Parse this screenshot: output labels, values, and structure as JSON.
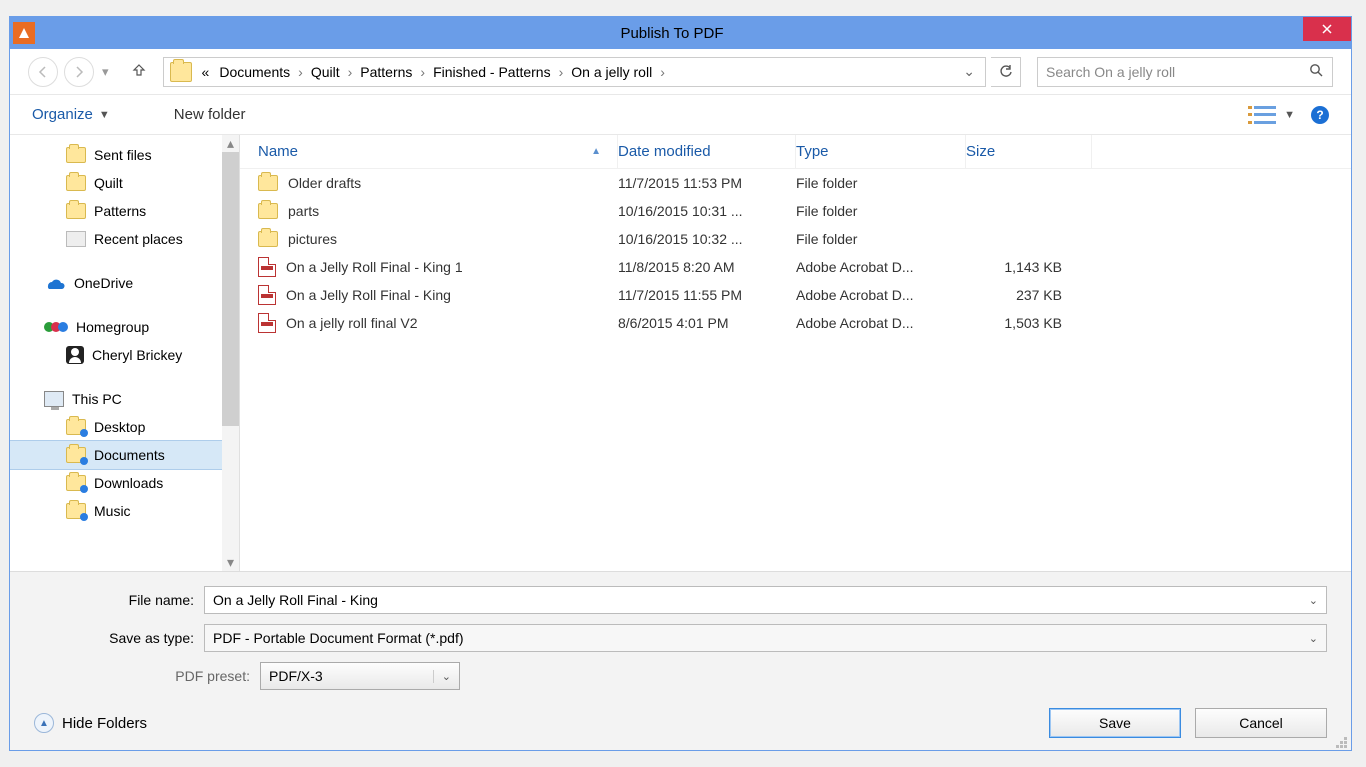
{
  "window": {
    "title": "Publish To PDF"
  },
  "breadcrumbs": {
    "prefix": "«",
    "items": [
      "Documents",
      "Quilt",
      "Patterns",
      "Finished - Patterns",
      "On a jelly roll"
    ]
  },
  "search": {
    "placeholder": "Search On a jelly roll"
  },
  "toolbar": {
    "organize": "Organize",
    "newfolder": "New folder"
  },
  "sidebar": {
    "items": [
      {
        "icon": "folder",
        "label": "Sent files",
        "indent": "sub"
      },
      {
        "icon": "folder",
        "label": "Quilt",
        "indent": "sub"
      },
      {
        "icon": "folder",
        "label": "Patterns",
        "indent": "sub"
      },
      {
        "icon": "recent",
        "label": "Recent places",
        "indent": "sub"
      },
      {
        "gap": true
      },
      {
        "icon": "onedrive",
        "label": "OneDrive",
        "indent": "top"
      },
      {
        "gap": true
      },
      {
        "icon": "homegroup",
        "label": "Homegroup",
        "indent": "top"
      },
      {
        "icon": "user",
        "label": "Cheryl Brickey",
        "indent": "sub"
      },
      {
        "gap": true
      },
      {
        "icon": "pc",
        "label": "This PC",
        "indent": "top"
      },
      {
        "icon": "folder-blue",
        "label": "Desktop",
        "indent": "sub"
      },
      {
        "icon": "folder-blue",
        "label": "Documents",
        "indent": "sub",
        "selected": true
      },
      {
        "icon": "folder-blue",
        "label": "Downloads",
        "indent": "sub"
      },
      {
        "icon": "folder-blue",
        "label": "Music",
        "indent": "sub"
      }
    ]
  },
  "columns": {
    "name": "Name",
    "date": "Date modified",
    "type": "Type",
    "size": "Size"
  },
  "files": [
    {
      "icon": "folder",
      "name": "Older drafts",
      "date": "11/7/2015 11:53 PM",
      "type": "File folder",
      "size": ""
    },
    {
      "icon": "folder",
      "name": "parts",
      "date": "10/16/2015 10:31 ...",
      "type": "File folder",
      "size": ""
    },
    {
      "icon": "folder",
      "name": "pictures",
      "date": "10/16/2015 10:32 ...",
      "type": "File folder",
      "size": ""
    },
    {
      "icon": "pdf",
      "name": "On a Jelly Roll Final - King 1",
      "date": "11/8/2015 8:20 AM",
      "type": "Adobe Acrobat D...",
      "size": "1,143 KB"
    },
    {
      "icon": "pdf",
      "name": "On a Jelly Roll Final - King",
      "date": "11/7/2015 11:55 PM",
      "type": "Adobe Acrobat D...",
      "size": "237 KB"
    },
    {
      "icon": "pdf",
      "name": "On a jelly roll final V2",
      "date": "8/6/2015 4:01 PM",
      "type": "Adobe Acrobat D...",
      "size": "1,503 KB"
    }
  ],
  "form": {
    "filename_label": "File name:",
    "filename_value": "On a Jelly Roll Final - King",
    "saveastype_label": "Save as type:",
    "saveastype_value": "PDF - Portable Document Format (*.pdf)",
    "preset_label": "PDF preset:",
    "preset_value": "PDF/X-3"
  },
  "footer": {
    "hide_folders": "Hide Folders",
    "save": "Save",
    "cancel": "Cancel"
  }
}
